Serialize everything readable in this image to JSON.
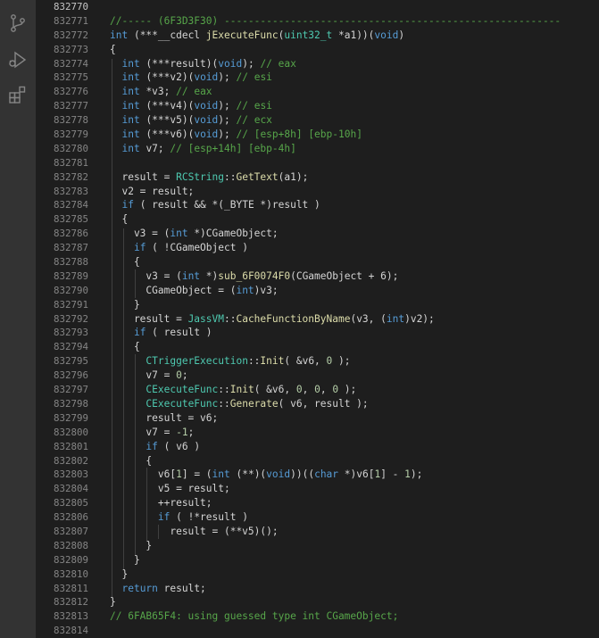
{
  "activity_bar": {
    "icons": [
      "source-control-icon",
      "run-debug-icon",
      "extensions-icon"
    ]
  },
  "editor": {
    "lines": [
      {
        "num": "832770",
        "tokens": []
      },
      {
        "num": "832771",
        "tokens": [
          [
            "cm",
            "//----- (6F3D3F30) --------------------------------------------------------"
          ]
        ]
      },
      {
        "num": "832772",
        "tokens": [
          [
            "kw",
            "int"
          ],
          [
            "id",
            " (***__cdecl "
          ],
          [
            "fn",
            "jExecuteFunc"
          ],
          [
            "id",
            "("
          ],
          [
            "cls",
            "uint32_t"
          ],
          [
            "id",
            " *a1))("
          ],
          [
            "kw",
            "void"
          ],
          [
            "id",
            ")"
          ]
        ]
      },
      {
        "num": "832773",
        "tokens": [
          [
            "id",
            "{"
          ]
        ]
      },
      {
        "num": "832774",
        "tokens": [
          [
            "id",
            "  "
          ],
          [
            "kw",
            "int"
          ],
          [
            "id",
            " (***result)("
          ],
          [
            "kw",
            "void"
          ],
          [
            "id",
            "); "
          ],
          [
            "cm",
            "// eax"
          ]
        ]
      },
      {
        "num": "832775",
        "tokens": [
          [
            "id",
            "  "
          ],
          [
            "kw",
            "int"
          ],
          [
            "id",
            " (***v2)("
          ],
          [
            "kw",
            "void"
          ],
          [
            "id",
            "); "
          ],
          [
            "cm",
            "// esi"
          ]
        ]
      },
      {
        "num": "832776",
        "tokens": [
          [
            "id",
            "  "
          ],
          [
            "kw",
            "int"
          ],
          [
            "id",
            " *v3; "
          ],
          [
            "cm",
            "// eax"
          ]
        ]
      },
      {
        "num": "832777",
        "tokens": [
          [
            "id",
            "  "
          ],
          [
            "kw",
            "int"
          ],
          [
            "id",
            " (***v4)("
          ],
          [
            "kw",
            "void"
          ],
          [
            "id",
            "); "
          ],
          [
            "cm",
            "// esi"
          ]
        ]
      },
      {
        "num": "832778",
        "tokens": [
          [
            "id",
            "  "
          ],
          [
            "kw",
            "int"
          ],
          [
            "id",
            " (***v5)("
          ],
          [
            "kw",
            "void"
          ],
          [
            "id",
            "); "
          ],
          [
            "cm",
            "// ecx"
          ]
        ]
      },
      {
        "num": "832779",
        "tokens": [
          [
            "id",
            "  "
          ],
          [
            "kw",
            "int"
          ],
          [
            "id",
            " (***v6)("
          ],
          [
            "kw",
            "void"
          ],
          [
            "id",
            "); "
          ],
          [
            "cm",
            "// [esp+8h] [ebp-10h]"
          ]
        ]
      },
      {
        "num": "832780",
        "tokens": [
          [
            "id",
            "  "
          ],
          [
            "kw",
            "int"
          ],
          [
            "id",
            " v7; "
          ],
          [
            "cm",
            "// [esp+14h] [ebp-4h]"
          ]
        ]
      },
      {
        "num": "832781",
        "tokens": []
      },
      {
        "num": "832782",
        "tokens": [
          [
            "id",
            "  result = "
          ],
          [
            "cls",
            "RCString"
          ],
          [
            "id",
            "::"
          ],
          [
            "fn",
            "GetText"
          ],
          [
            "id",
            "(a1);"
          ]
        ]
      },
      {
        "num": "832783",
        "tokens": [
          [
            "id",
            "  v2 = result;"
          ]
        ]
      },
      {
        "num": "832784",
        "tokens": [
          [
            "id",
            "  "
          ],
          [
            "kw",
            "if"
          ],
          [
            "id",
            " ( result && *(_BYTE *)result )"
          ]
        ]
      },
      {
        "num": "832785",
        "tokens": [
          [
            "id",
            "  {"
          ]
        ]
      },
      {
        "num": "832786",
        "tokens": [
          [
            "id",
            "    v3 = ("
          ],
          [
            "kw",
            "int"
          ],
          [
            "id",
            " *)CGameObject;"
          ]
        ]
      },
      {
        "num": "832787",
        "tokens": [
          [
            "id",
            "    "
          ],
          [
            "kw",
            "if"
          ],
          [
            "id",
            " ( !CGameObject )"
          ]
        ]
      },
      {
        "num": "832788",
        "tokens": [
          [
            "id",
            "    {"
          ]
        ]
      },
      {
        "num": "832789",
        "tokens": [
          [
            "id",
            "      v3 = ("
          ],
          [
            "kw",
            "int"
          ],
          [
            "id",
            " *)"
          ],
          [
            "fn",
            "sub_6F0074F0"
          ],
          [
            "id",
            "(CGameObject + 6);"
          ]
        ]
      },
      {
        "num": "832790",
        "tokens": [
          [
            "id",
            "      CGameObject = ("
          ],
          [
            "kw",
            "int"
          ],
          [
            "id",
            ")v3;"
          ]
        ]
      },
      {
        "num": "832791",
        "tokens": [
          [
            "id",
            "    }"
          ]
        ]
      },
      {
        "num": "832792",
        "tokens": [
          [
            "id",
            "    result = "
          ],
          [
            "cls",
            "JassVM"
          ],
          [
            "id",
            "::"
          ],
          [
            "fn",
            "CacheFunctionByName"
          ],
          [
            "id",
            "(v3, ("
          ],
          [
            "kw",
            "int"
          ],
          [
            "id",
            ")v2);"
          ]
        ]
      },
      {
        "num": "832793",
        "tokens": [
          [
            "id",
            "    "
          ],
          [
            "kw",
            "if"
          ],
          [
            "id",
            " ( result )"
          ]
        ]
      },
      {
        "num": "832794",
        "tokens": [
          [
            "id",
            "    {"
          ]
        ]
      },
      {
        "num": "832795",
        "tokens": [
          [
            "id",
            "      "
          ],
          [
            "cls",
            "CTriggerExecution"
          ],
          [
            "id",
            "::"
          ],
          [
            "fn",
            "Init"
          ],
          [
            "id",
            "( &v6, "
          ],
          [
            "num",
            "0"
          ],
          [
            "id",
            " );"
          ]
        ]
      },
      {
        "num": "832796",
        "tokens": [
          [
            "id",
            "      v7 = "
          ],
          [
            "num",
            "0"
          ],
          [
            "id",
            ";"
          ]
        ]
      },
      {
        "num": "832797",
        "tokens": [
          [
            "id",
            "      "
          ],
          [
            "cls",
            "CExecuteFunc"
          ],
          [
            "id",
            "::"
          ],
          [
            "fn",
            "Init"
          ],
          [
            "id",
            "( &v6, "
          ],
          [
            "num",
            "0"
          ],
          [
            "id",
            ", "
          ],
          [
            "num",
            "0"
          ],
          [
            "id",
            ", "
          ],
          [
            "num",
            "0"
          ],
          [
            "id",
            " );"
          ]
        ]
      },
      {
        "num": "832798",
        "tokens": [
          [
            "id",
            "      "
          ],
          [
            "cls",
            "CExecuteFunc"
          ],
          [
            "id",
            "::"
          ],
          [
            "fn",
            "Generate"
          ],
          [
            "id",
            "( v6, result );"
          ]
        ]
      },
      {
        "num": "832799",
        "tokens": [
          [
            "id",
            "      result = v6;"
          ]
        ]
      },
      {
        "num": "832800",
        "tokens": [
          [
            "id",
            "      v7 = "
          ],
          [
            "num",
            "-1"
          ],
          [
            "id",
            ";"
          ]
        ]
      },
      {
        "num": "832801",
        "tokens": [
          [
            "id",
            "      "
          ],
          [
            "kw",
            "if"
          ],
          [
            "id",
            " ( v6 )"
          ]
        ]
      },
      {
        "num": "832802",
        "tokens": [
          [
            "id",
            "      {"
          ]
        ]
      },
      {
        "num": "832803",
        "tokens": [
          [
            "id",
            "        v6["
          ],
          [
            "num",
            "1"
          ],
          [
            "id",
            "] = ("
          ],
          [
            "kw",
            "int"
          ],
          [
            "id",
            " (**)("
          ],
          [
            "kw",
            "void"
          ],
          [
            "id",
            "))(("
          ],
          [
            "kw",
            "char"
          ],
          [
            "id",
            " *)v6["
          ],
          [
            "num",
            "1"
          ],
          [
            "id",
            "] - "
          ],
          [
            "num",
            "1"
          ],
          [
            "id",
            ");"
          ]
        ]
      },
      {
        "num": "832804",
        "tokens": [
          [
            "id",
            "        v5 = result;"
          ]
        ]
      },
      {
        "num": "832805",
        "tokens": [
          [
            "id",
            "        ++result;"
          ]
        ]
      },
      {
        "num": "832806",
        "tokens": [
          [
            "id",
            "        "
          ],
          [
            "kw",
            "if"
          ],
          [
            "id",
            " ( !*result )"
          ]
        ]
      },
      {
        "num": "832807",
        "tokens": [
          [
            "id",
            "          result = (**v5)();"
          ]
        ]
      },
      {
        "num": "832808",
        "tokens": [
          [
            "id",
            "      }"
          ]
        ]
      },
      {
        "num": "832809",
        "tokens": [
          [
            "id",
            "    }"
          ]
        ]
      },
      {
        "num": "832810",
        "tokens": [
          [
            "id",
            "  }"
          ]
        ]
      },
      {
        "num": "832811",
        "tokens": [
          [
            "id",
            "  "
          ],
          [
            "kw",
            "return"
          ],
          [
            "id",
            " result;"
          ]
        ]
      },
      {
        "num": "832812",
        "tokens": [
          [
            "id",
            "}"
          ]
        ]
      },
      {
        "num": "832813",
        "tokens": [
          [
            "cm",
            "// 6FAB65F4: using guessed type int CGameObject;"
          ]
        ]
      },
      {
        "num": "832814",
        "tokens": []
      }
    ]
  }
}
